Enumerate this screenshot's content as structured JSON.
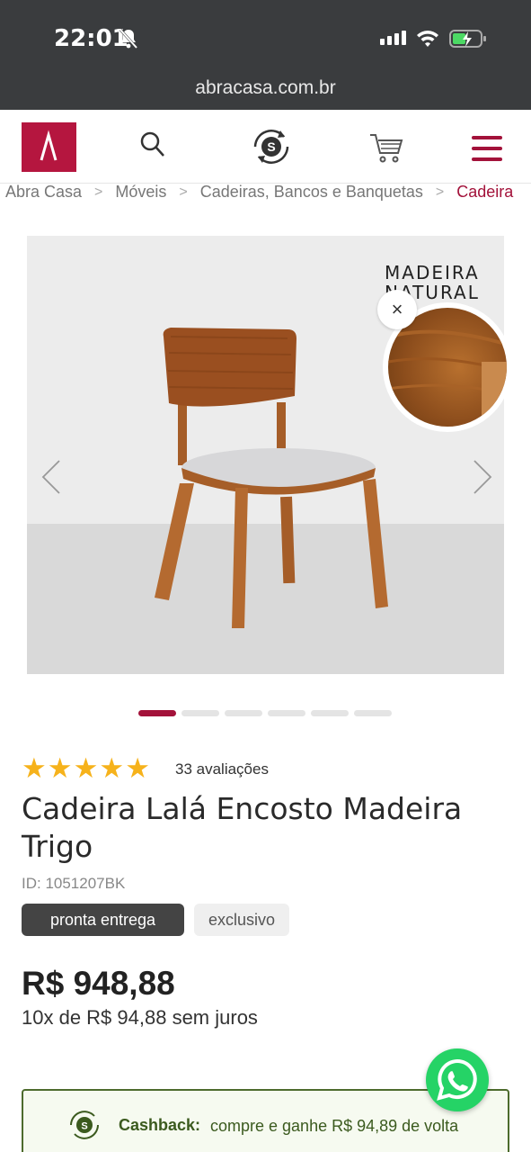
{
  "status": {
    "time": "22:01"
  },
  "browser": {
    "url": "abracasa.com.br"
  },
  "breadcrumb": [
    "Abra Casa",
    "Móveis",
    "Cadeiras, Bancos e Banquetas",
    "Cadeira"
  ],
  "gallery": {
    "promo_line1": "MADEIRA",
    "promo_line2": "NATURAL",
    "close": "×",
    "slide_index": 1,
    "slide_count": 6
  },
  "product": {
    "rating": 5,
    "reviews": "33 avaliações",
    "title": "Cadeira Lalá Encosto Madeira Trigo",
    "id": "ID: 1051207BK",
    "badges": [
      "pronta entrega",
      "exclusivo"
    ],
    "price": "R$ 948,88",
    "installments": "10x de R$ 94,88 sem juros"
  },
  "cashback": {
    "label": "Cashback:",
    "text": "compre e ganhe R$ 94,89 de volta"
  },
  "colors": {
    "brand": "#b5163f",
    "cashback_green": "#4d6b2d",
    "star": "#f6b21b",
    "whatsapp": "#25d366"
  }
}
